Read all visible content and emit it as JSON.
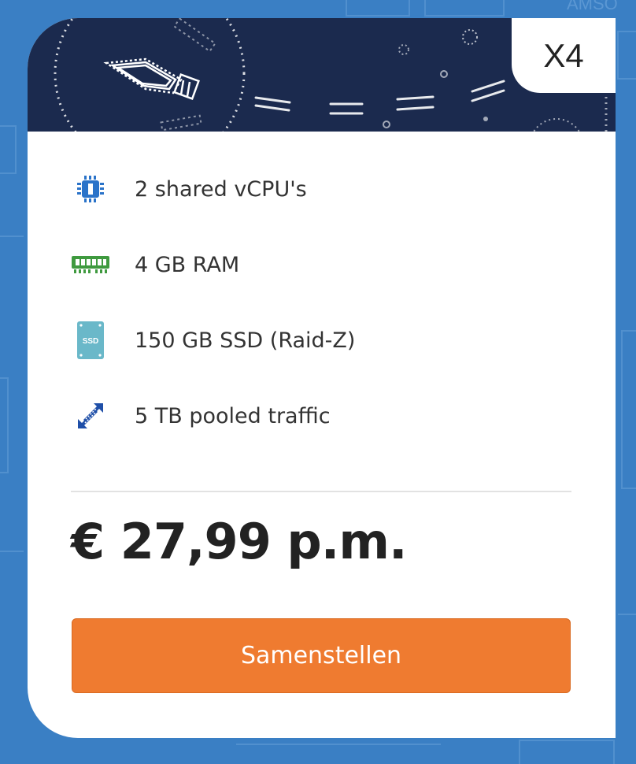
{
  "plan": {
    "tag": "X4"
  },
  "features": [
    {
      "icon": "cpu-icon",
      "label": "2 shared vCPU's"
    },
    {
      "icon": "ram-icon",
      "label": "4 GB RAM"
    },
    {
      "icon": "ssd-icon",
      "label": "150 GB SSD (Raid-Z)",
      "icon_text": "SSD"
    },
    {
      "icon": "traffic-arrows-icon",
      "label": "5 TB pooled traffic"
    }
  ],
  "price": "€ 27,99 p.m.",
  "cta": {
    "label": "Samenstellen"
  },
  "colors": {
    "background": "#3a7fc4",
    "banner": "#1b2a4e",
    "cta": "#ef7b30",
    "cpu_icon": "#2a73c9",
    "ram_icon": "#3f9a3f",
    "ssd_icon": "#6ab8c9",
    "traffic_icon": "#1f4fa8"
  }
}
